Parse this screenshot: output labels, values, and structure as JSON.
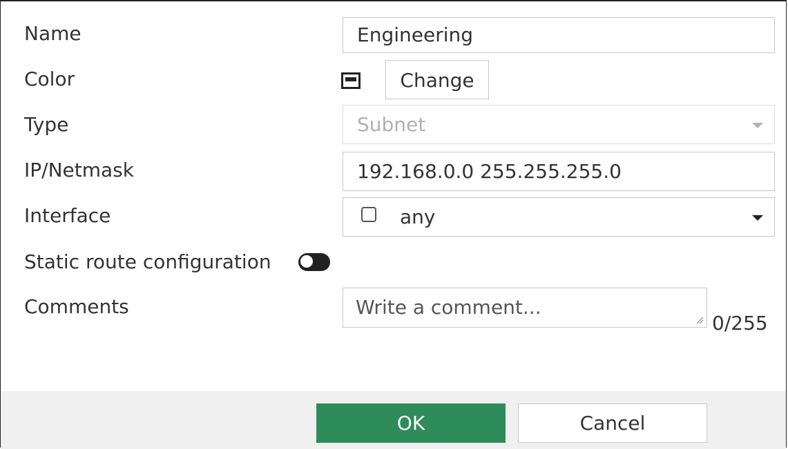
{
  "form": {
    "name": {
      "label": "Name",
      "value": "Engineering"
    },
    "color": {
      "label": "Color",
      "swatch_icon": "color-swatch-icon",
      "change_label": "Change"
    },
    "type": {
      "label": "Type",
      "value": "Subnet",
      "disabled": true
    },
    "ip_netmask": {
      "label": "IP/Netmask",
      "value": "192.168.0.0 255.255.255.0"
    },
    "interface": {
      "label": "Interface",
      "value": "any"
    },
    "static_route": {
      "label": "Static route configuration",
      "enabled": false
    },
    "comments": {
      "label": "Comments",
      "placeholder": "Write a comment...",
      "counter": "0/255"
    }
  },
  "footer": {
    "ok_label": "OK",
    "cancel_label": "Cancel"
  },
  "colors": {
    "ok_button": "#2e8b5a",
    "footer_bg": "#f0f0f0",
    "border": "#c8c8c8"
  }
}
